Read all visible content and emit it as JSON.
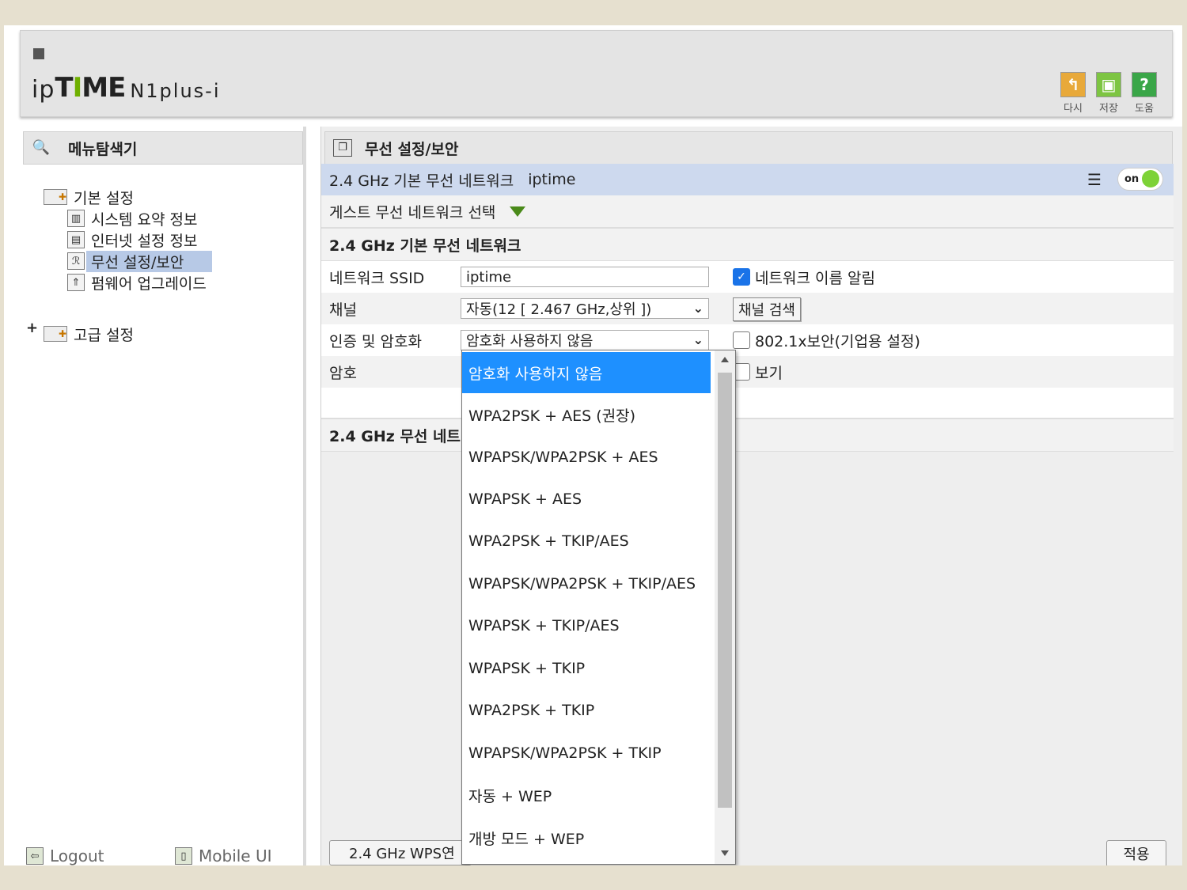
{
  "header": {
    "brand_ip": "ip",
    "brand_t": "T",
    "brand_i": "I",
    "brand_me": "ME",
    "model": "N1plus-i",
    "buttons": {
      "redo": "다시",
      "save": "저장",
      "help": "도움"
    }
  },
  "left_panel": {
    "title": "메뉴탐색기",
    "tree": {
      "basic": "기본 설정",
      "items": [
        "시스템 요약 정보",
        "인터넷 설정 정보",
        "무선 설정/보안",
        "펌웨어 업그레이드"
      ],
      "advanced_expander": "+",
      "advanced": "고급 설정"
    },
    "footer": {
      "logout": "Logout",
      "mobile": "Mobile UI"
    }
  },
  "right_panel": {
    "title": "무선 설정/보안",
    "network_bar": {
      "name": "2.4 GHz 기본 무선 네트워크",
      "ssid": "iptime",
      "toggle": "on"
    },
    "guest_select": "게스트 무선 네트워크 선택",
    "section1": "2.4 GHz 기본 무선 네트워크",
    "rows": {
      "ssid_label": "네트워크 SSID",
      "ssid_value": "iptime",
      "broadcast_label": "네트워크 이름 알림",
      "channel_label": "채널",
      "channel_value": "자동(12 [ 2.467 GHz,상위 ])",
      "scan_button": "채널 검색",
      "auth_label": "인증 및 암호화",
      "auth_value": "암호화 사용하지 않음",
      "enterprise_label": "802.1x보안(기업용 설정)",
      "password_label": "암호",
      "show_label": "보기"
    },
    "section2": "2.4 GHz 무선 네트",
    "wps_button": "2.4 GHz WPS연",
    "apply_button": "적용"
  },
  "dropdown": {
    "options": [
      "암호화 사용하지 않음",
      "WPA2PSK + AES (권장)",
      "WPAPSK/WPA2PSK + AES",
      "WPAPSK + AES",
      "WPA2PSK + TKIP/AES",
      "WPAPSK/WPA2PSK + TKIP/AES",
      "WPAPSK + TKIP/AES",
      "WPAPSK + TKIP",
      "WPA2PSK + TKIP",
      "WPAPSK/WPA2PSK + TKIP",
      "자동 + WEP",
      "개방 모드 + WEP"
    ],
    "selected": "암호화 사용하지 않음"
  },
  "colors": {
    "accent_selected": "#1e90ff",
    "brand_green": "#6fb000",
    "toggle_on": "#7dd237",
    "tree_highlight": "#b7c9e6"
  }
}
